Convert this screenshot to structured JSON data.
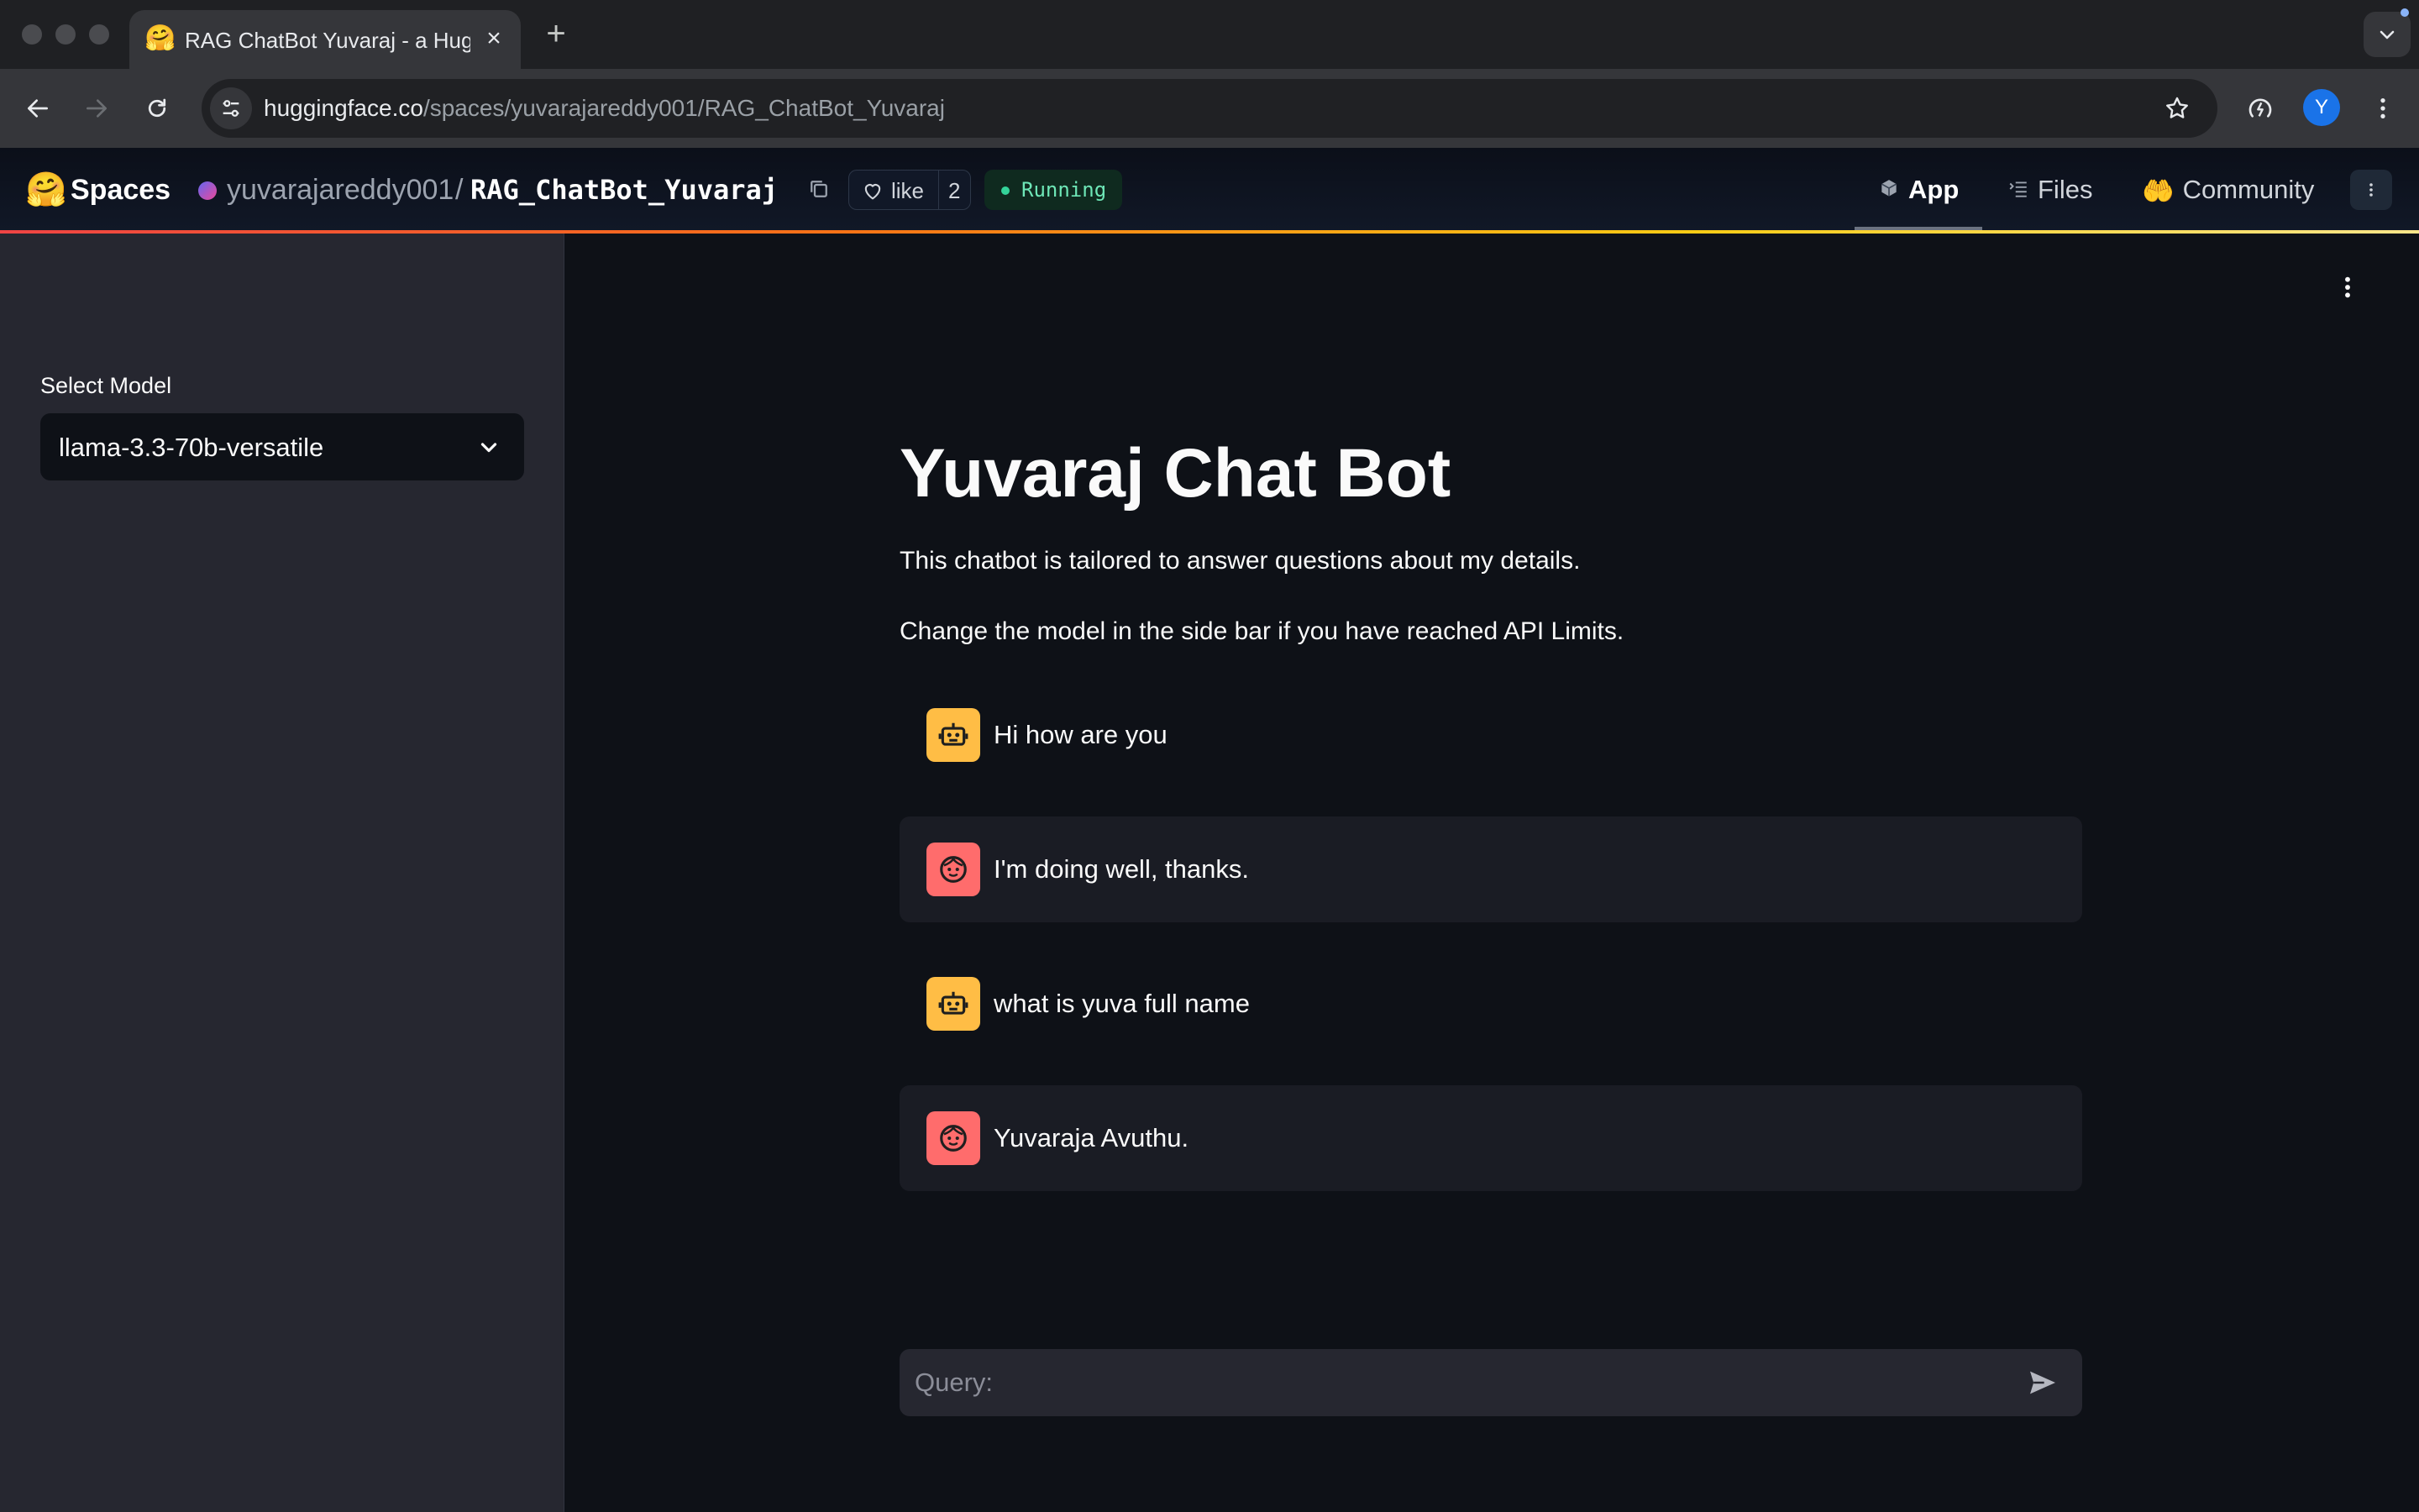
{
  "browser": {
    "tab": {
      "title": "RAG ChatBot Yuvaraj - a Hugging Face Space",
      "favicon": "🤗"
    },
    "address_bar": {
      "domain": "huggingface.co",
      "path": "/spaces/yuvarajareddy001/RAG_ChatBot_Yuvaraj"
    },
    "profile_initial": "Y"
  },
  "hf_header": {
    "logo": "🤗",
    "spaces_label": "Spaces",
    "owner": "yuvarajareddy001",
    "separator": "/",
    "repo": "RAG_ChatBot_Yuvaraj",
    "like_label": "like",
    "like_count": "2",
    "status": "Running",
    "nav": {
      "app": "App",
      "files": "Files",
      "community": "Community",
      "community_icon": "🤲"
    }
  },
  "sidebar": {
    "select_label": "Select Model",
    "select_value": "llama-3.3-70b-versatile"
  },
  "main": {
    "title": "Yuvaraj Chat Bot",
    "description_1": "This chatbot is tailored to answer questions about my details.",
    "description_2": "Change the model in the side bar if you have reached API Limits.",
    "messages": [
      {
        "role": "user",
        "text": "Hi how are you"
      },
      {
        "role": "assistant",
        "text": "I'm doing well, thanks."
      },
      {
        "role": "user",
        "text": "what is yuva full name"
      },
      {
        "role": "assistant",
        "text": "Yuvaraja Avuthu."
      }
    ],
    "chat_input_placeholder": "Query:"
  },
  "colors": {
    "user_avatar": "#ffbd45",
    "assistant_avatar": "#ff6c6c",
    "running_dot": "#34d399",
    "background": "#0e1117",
    "sidebar": "#262730"
  }
}
